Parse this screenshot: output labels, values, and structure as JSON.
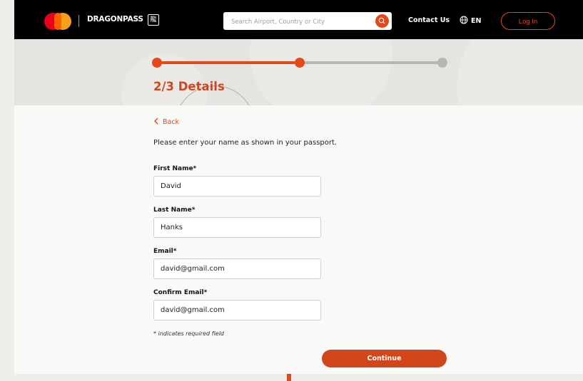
{
  "header": {
    "brand": "DRAGONPASS",
    "brand_mark": "龍",
    "search": {
      "placeholder": "Search Airport, Country or City",
      "icon": "search-icon"
    },
    "contact_label": "Contact Us",
    "language_label": "EN",
    "login_label": "Log In"
  },
  "progress": {
    "current_step": 2,
    "total_steps": 3,
    "title": "2/3 Details"
  },
  "form": {
    "back_label": "Back",
    "intro": "Please enter your name as shown in your passport.",
    "fields": [
      {
        "label": "First Name*",
        "value": "David"
      },
      {
        "label": "Last Name*",
        "value": "Hanks"
      },
      {
        "label": "Email*",
        "value": "david@gmail.com"
      },
      {
        "label": "Confirm Email*",
        "value": "david@gmail.com"
      }
    ],
    "required_note": "* indicates required field",
    "continue_label": "Continue"
  },
  "colors": {
    "accent": "#e2491a",
    "header_bg": "#000000",
    "inactive_step": "#b8b6b3"
  }
}
